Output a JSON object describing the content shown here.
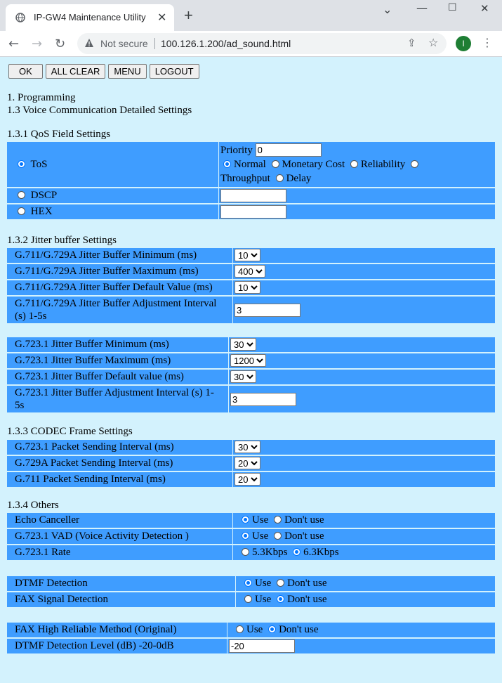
{
  "browser": {
    "tab_title": "IP-GW4 Maintenance Utility",
    "not_secure": "Not secure",
    "url": "100.126.1.200/ad_sound.html",
    "avatar_letter": "I"
  },
  "buttons": {
    "ok": "OK",
    "all_clear": "ALL CLEAR",
    "menu": "MENU",
    "logout": "LOGOUT"
  },
  "headings": {
    "programming": "1. Programming",
    "voice": "1.3 Voice Communication Detailed Settings",
    "qos": "1.3.1 QoS Field Settings",
    "jitter": "1.3.2 Jitter buffer Settings",
    "codec": "1.3.3 CODEC Frame Settings",
    "others": "1.3.4 Others"
  },
  "qos": {
    "tos": "ToS",
    "priority_label": "Priority",
    "priority_value": "0",
    "normal": "Normal",
    "monetary": "Monetary Cost",
    "reliability": "Reliability",
    "throughput": "Throughput",
    "delay": "Delay",
    "dscp": "DSCP",
    "hex": "HEX"
  },
  "jitter_g711": [
    {
      "label": "G.711/G.729A Jitter Buffer Minimum (ms)",
      "value": "10"
    },
    {
      "label": "G.711/G.729A Jitter Buffer Maximum (ms)",
      "value": "400"
    },
    {
      "label": "G.711/G.729A Jitter Buffer Default Value (ms)",
      "value": "10"
    },
    {
      "label": "G.711/G.729A Jitter Buffer Adjustment Interval (s) 1-5s",
      "value": "3"
    }
  ],
  "jitter_g723": [
    {
      "label": "G.723.1 Jitter Buffer Minimum (ms)",
      "value": "30"
    },
    {
      "label": "G.723.1 Jitter Buffer Maximum (ms)",
      "value": "1200"
    },
    {
      "label": "G.723.1 Jitter Buffer Default value (ms)",
      "value": "30"
    },
    {
      "label": "G.723.1 Jitter Buffer Adjustment Interval (s) 1-5s",
      "value": "3"
    }
  ],
  "codec": [
    {
      "label": "G.723.1 Packet Sending Interval (ms)",
      "value": "30"
    },
    {
      "label": "G.729A Packet Sending Interval (ms)",
      "value": "20"
    },
    {
      "label": "G.711 Packet Sending Interval (ms)",
      "value": "20"
    }
  ],
  "others": {
    "use": "Use",
    "dont_use": "Don't use",
    "echo": "Echo Canceller",
    "vad": "G.723.1 VAD (Voice Activity Detection )",
    "rate": "G.723.1 Rate",
    "rate_a": "5.3Kbps",
    "rate_b": "6.3Kbps",
    "dtmf": "DTMF Detection",
    "fax": "FAX Signal Detection",
    "fax_high": "FAX High Reliable Method (Original)",
    "dtmf_level": "DTMF Detection Level (dB) -20-0dB",
    "dtmf_level_value": "-20"
  }
}
